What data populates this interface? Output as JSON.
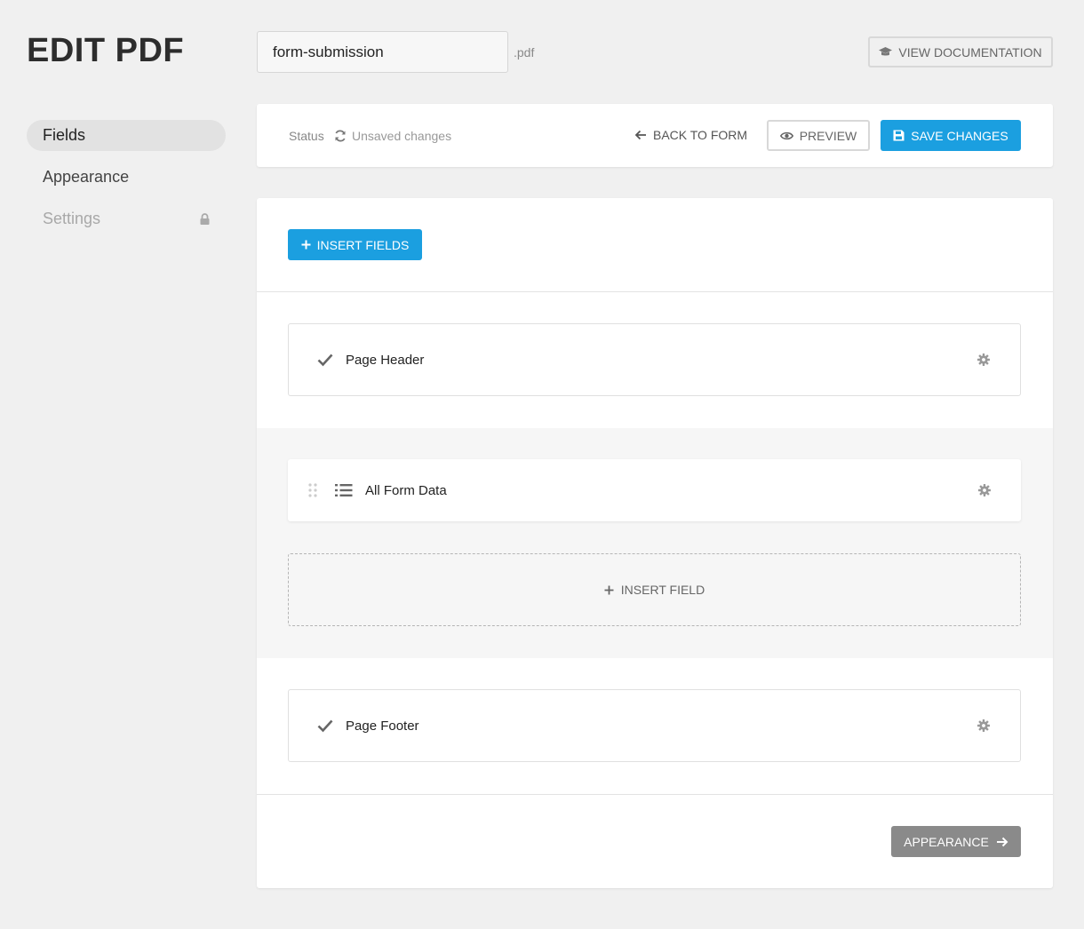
{
  "header": {
    "title": "EDIT PDF",
    "filename_value": "form-submission",
    "filename_extension": ".pdf",
    "docs_button_label": "VIEW DOCUMENTATION"
  },
  "sidebar": {
    "items": [
      {
        "label": "Fields",
        "active": true
      },
      {
        "label": "Appearance",
        "active": false
      },
      {
        "label": "Settings",
        "locked": true
      }
    ]
  },
  "toolbar": {
    "status_label": "Status",
    "status_value": "Unsaved changes",
    "back_label": "BACK TO FORM",
    "preview_label": "PREVIEW",
    "save_label": "SAVE CHANGES"
  },
  "editor": {
    "insert_fields_label": "INSERT FIELDS",
    "header_field": "Page Header",
    "data_field": "All Form Data",
    "insert_field_label": "INSERT FIELD",
    "footer_field": "Page Footer",
    "next_label": "APPEARANCE"
  },
  "colors": {
    "accent": "#1b9fe0",
    "next_button": "#8a8a8a",
    "background": "#f0f0f0"
  }
}
